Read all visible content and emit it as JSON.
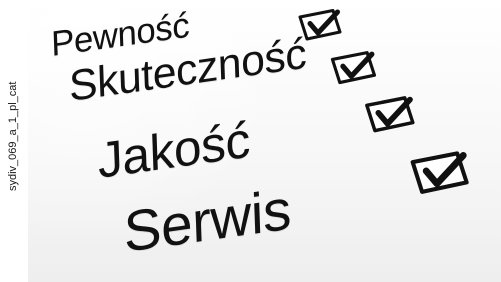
{
  "side_code": "sydiv_069_a_1_pl_cat",
  "checklist": {
    "items": [
      {
        "label": "Pewność",
        "checked": true
      },
      {
        "label": "Skuteczność",
        "checked": true
      },
      {
        "label": "Jakość",
        "checked": true
      },
      {
        "label": "Serwis",
        "checked": false
      }
    ]
  }
}
